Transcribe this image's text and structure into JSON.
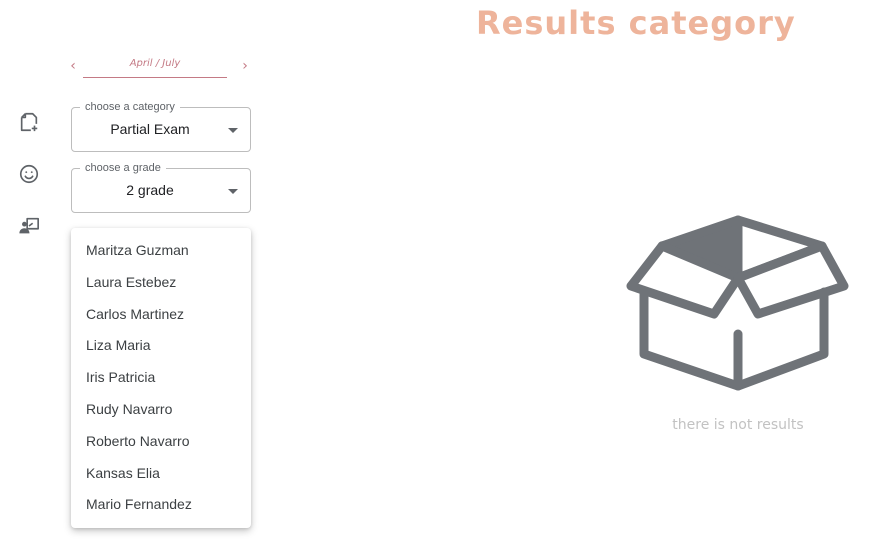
{
  "header": {
    "title": "Results category"
  },
  "sidebar": {
    "icons": [
      {
        "name": "add-document-icon"
      },
      {
        "name": "smiley-face-icon"
      },
      {
        "name": "teacher-board-icon"
      }
    ]
  },
  "filters": {
    "period": {
      "label": "April / July",
      "prev_icon": "chevron-left-icon",
      "next_icon": "chevron-right-icon"
    },
    "category": {
      "legend": "choose a category",
      "value": "Partial Exam"
    },
    "grade": {
      "legend": "choose a grade",
      "value": "2 grade"
    }
  },
  "student_menu": {
    "items": [
      "Maritza Guzman",
      "Laura Estebez",
      "Carlos Martinez",
      "Liza Maria",
      "Iris Patricia",
      "Rudy Navarro",
      "Roberto Navarro",
      "Kansas Elia",
      "Mario Fernandez"
    ]
  },
  "empty_state": {
    "icon": "open-box-icon",
    "message": "there is not results"
  },
  "colors": {
    "title": "#eeb49b",
    "period_accent": "#c47a85",
    "icon_gray": "#6f7378",
    "empty_text": "#c2c2c2",
    "outline": "#bdbdbd"
  }
}
